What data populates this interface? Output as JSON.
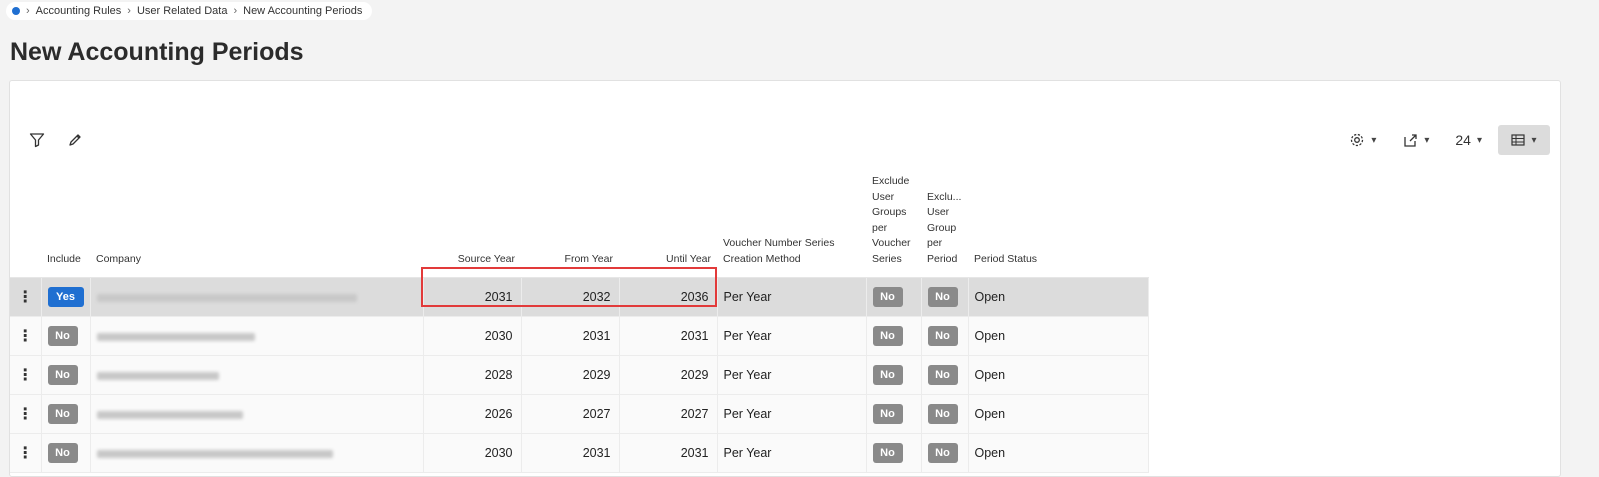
{
  "breadcrumb": {
    "items": [
      "Accounting Rules",
      "User Related Data",
      "New Accounting Periods"
    ]
  },
  "page": {
    "title": "New Accounting Periods"
  },
  "toolbar": {
    "page_size": "24"
  },
  "table": {
    "headers": {
      "include": "Include",
      "company": "Company",
      "source_year": "Source Year",
      "from_year": "From Year",
      "until_year": "Until Year",
      "voucher_method": "Voucher Number Series Creation Method",
      "excl_voucher": "Exclude User Groups per Voucher Series",
      "excl_period": "Exclu... User Group per Period",
      "period_status": "Period Status"
    },
    "rows": [
      {
        "include": "Yes",
        "source_year": "2031",
        "from_year": "2032",
        "until_year": "2036",
        "method": "Per Year",
        "excl_voucher": "No",
        "excl_period": "No",
        "status": "Open"
      },
      {
        "include": "No",
        "source_year": "2030",
        "from_year": "2031",
        "until_year": "2031",
        "method": "Per Year",
        "excl_voucher": "No",
        "excl_period": "No",
        "status": "Open"
      },
      {
        "include": "No",
        "source_year": "2028",
        "from_year": "2029",
        "until_year": "2029",
        "method": "Per Year",
        "excl_voucher": "No",
        "excl_period": "No",
        "status": "Open"
      },
      {
        "include": "No",
        "source_year": "2026",
        "from_year": "2027",
        "until_year": "2027",
        "method": "Per Year",
        "excl_voucher": "No",
        "excl_period": "No",
        "status": "Open"
      },
      {
        "include": "No",
        "source_year": "2030",
        "from_year": "2031",
        "until_year": "2031",
        "method": "Per Year",
        "excl_voucher": "No",
        "excl_period": "No",
        "status": "Open"
      }
    ]
  },
  "colors": {
    "accent": "#1f6fd1",
    "badge_no": "#8a8a8a",
    "highlight": "#e23a3a",
    "selected_row": "#dcdcdc"
  },
  "icons": [
    "home-icon",
    "filter-icon",
    "pencil-icon",
    "gear-icon",
    "export-icon",
    "table-view-icon",
    "row-menu-icon",
    "chevron-down-icon"
  ]
}
